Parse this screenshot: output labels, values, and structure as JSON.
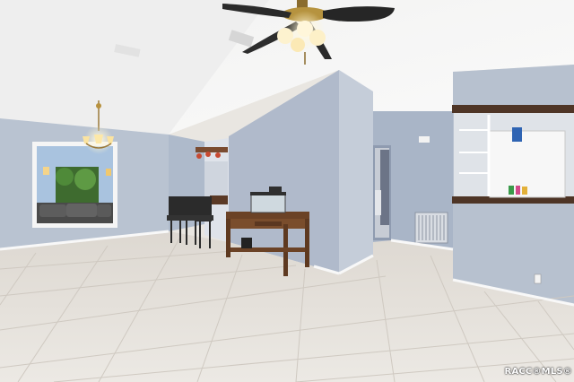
{
  "photo": {
    "subject": "interior-living-room",
    "watermark_text": "RACC®MLS®"
  },
  "colors": {
    "wall": "#b8c2d0",
    "ceiling": "#f3f3f2",
    "floor": "#e6e2dc",
    "wood": "#6b4226",
    "baseboard": "#f7f7f7"
  }
}
